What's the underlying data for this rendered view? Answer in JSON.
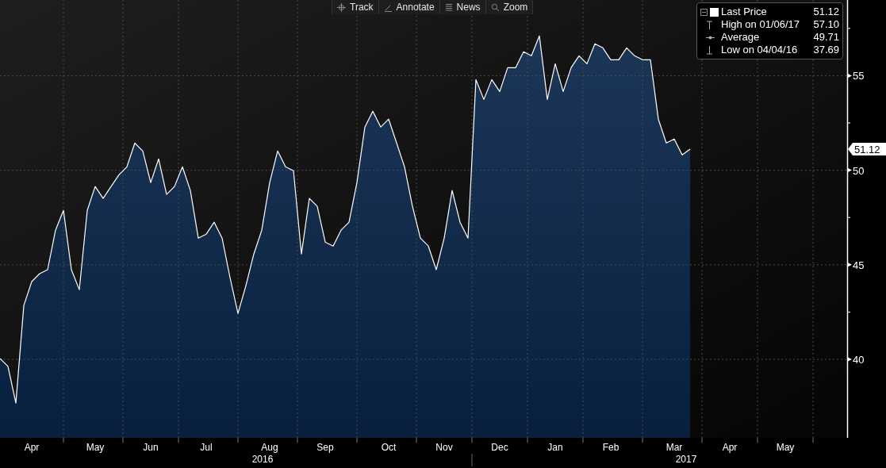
{
  "toolbar": [
    {
      "label": "Track"
    },
    {
      "label": "Annotate"
    },
    {
      "label": "News"
    },
    {
      "label": "Zoom"
    }
  ],
  "legend": {
    "items": [
      {
        "kind": "last",
        "value": "51.12"
      },
      {
        "kind": "high",
        "label": "High on 01/06/17",
        "value": "57.10"
      },
      {
        "kind": "average",
        "label": "Average",
        "value": "49.71"
      },
      {
        "kind": "low",
        "label": "Low on 04/04/16",
        "value": "37.69"
      }
    ]
  },
  "chart": {
    "chart_data": {
      "type": "area",
      "grid": true,
      "ylim": [
        35.85,
        59
      ],
      "yticks": [
        40,
        45,
        50,
        55
      ],
      "categories": [
        null,
        null,
        null,
        null,
        "Apr",
        null,
        null,
        null,
        null,
        null,
        null,
        null,
        "May",
        null,
        null,
        null,
        null,
        null,
        null,
        "Jun",
        null,
        null,
        null,
        null,
        null,
        null,
        "Jul",
        null,
        null,
        null,
        null,
        null,
        null,
        null,
        "Aug",
        null,
        null,
        null,
        null,
        null,
        null,
        "Sep",
        null,
        null,
        null,
        null,
        null,
        null,
        null,
        "Oct",
        null,
        null,
        null,
        null,
        null,
        null,
        "Nov",
        null,
        null,
        null,
        null,
        null,
        null,
        "Dec",
        null,
        null,
        null,
        null,
        null,
        null,
        "Jan",
        null,
        null,
        null,
        null,
        null,
        null,
        "Feb",
        null,
        null,
        null,
        null,
        null,
        null,
        null,
        "Mar",
        null,
        null,
        null,
        null,
        null,
        null,
        "Apr",
        null,
        null,
        null,
        null,
        null,
        null,
        "May",
        null,
        null,
        null,
        null,
        null,
        null,
        null
      ],
      "series": [
        {
          "name": "Last Price",
          "color": "#ffffff",
          "values": [
            40.05,
            39.63,
            37.69,
            42.85,
            44.11,
            44.53,
            44.74,
            46.83,
            47.88,
            44.74,
            43.69,
            47.88,
            49.14,
            48.51,
            49.14,
            49.76,
            50.18,
            51.44,
            51.02,
            49.35,
            50.6,
            48.72,
            49.14,
            50.18,
            48.93,
            46.41,
            46.62,
            47.25,
            46.41,
            44.32,
            42.43,
            43.9,
            45.57,
            46.83,
            49.35,
            51.02,
            50.18,
            49.97,
            45.57,
            48.51,
            48.09,
            46.2,
            45.99,
            46.83,
            47.25,
            49.35,
            52.28,
            53.12,
            52.28,
            52.7,
            51.44,
            50.18,
            48.09,
            46.41,
            45.99,
            44.74,
            46.41,
            48.93,
            47.25,
            46.41,
            54.79,
            53.74,
            54.79,
            54.16,
            55.42,
            55.42,
            56.26,
            56.05,
            57.1,
            53.74,
            55.63,
            54.16,
            55.42,
            56.05,
            55.63,
            56.68,
            56.47,
            55.84,
            55.84,
            56.47,
            56.05,
            55.84,
            55.84,
            52.7,
            51.44,
            51.65,
            50.81,
            51.12,
            null,
            null,
            null,
            null,
            null,
            null,
            null,
            null,
            null,
            null,
            null,
            null,
            null,
            null,
            null,
            null,
            null,
            null,
            null
          ]
        }
      ]
    },
    "year_labels": [
      "2016",
      "2017"
    ],
    "last_price_tag": "51.12"
  }
}
